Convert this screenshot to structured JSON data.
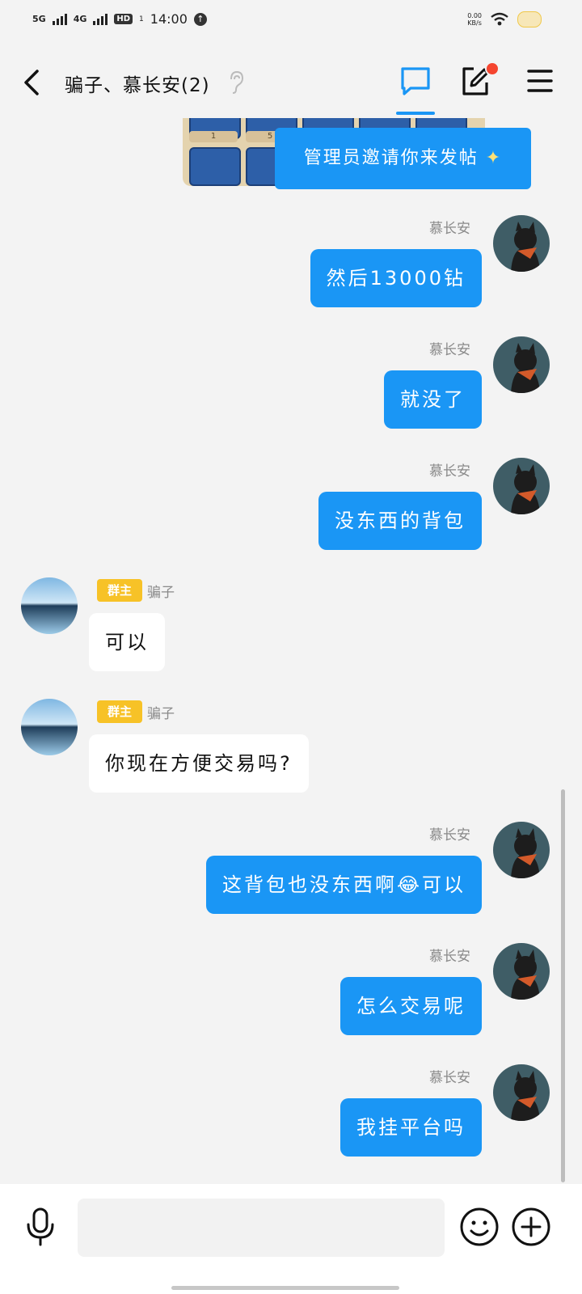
{
  "status_bar": {
    "net1": "5G",
    "net2": "4G",
    "hd": "HD",
    "hd_sub": "1",
    "time": "14:00",
    "speed_value": "0.00",
    "speed_unit": "KB/s"
  },
  "header": {
    "title": "骗子、慕长安(2)",
    "icons": [
      "back-arrow-icon",
      "ear-icon",
      "chat-bubble-icon",
      "edit-icon",
      "menu-icon"
    ],
    "accent": "#1a96f5",
    "notification_dot_color": "#f5452f"
  },
  "pinned_card": {
    "level_labels": [
      "1",
      "5"
    ],
    "invite_text": "管理员邀请你来发帖",
    "sparkle": "✦"
  },
  "messages": [
    {
      "direction": "out",
      "sender": "慕长安",
      "text": "然后13000钻"
    },
    {
      "direction": "out",
      "sender": "慕长安",
      "text": "就没了"
    },
    {
      "direction": "out",
      "sender": "慕长安",
      "text": "没东西的背包"
    },
    {
      "direction": "in",
      "badge": "群主",
      "sender": "骗子",
      "text": "可以"
    },
    {
      "direction": "in",
      "badge": "群主",
      "sender": "骗子",
      "text": "你现在方便交易吗?"
    },
    {
      "direction": "out",
      "sender": "慕长安",
      "text": "这背包也没东西啊😂可以"
    },
    {
      "direction": "out",
      "sender": "慕长安",
      "text": "怎么交易呢"
    },
    {
      "direction": "out",
      "sender": "慕长安",
      "text": "我挂平台吗"
    }
  ],
  "bottom_bar": {
    "input_placeholder": "",
    "icons": [
      "mic-icon",
      "emoji-icon",
      "plus-icon"
    ]
  }
}
